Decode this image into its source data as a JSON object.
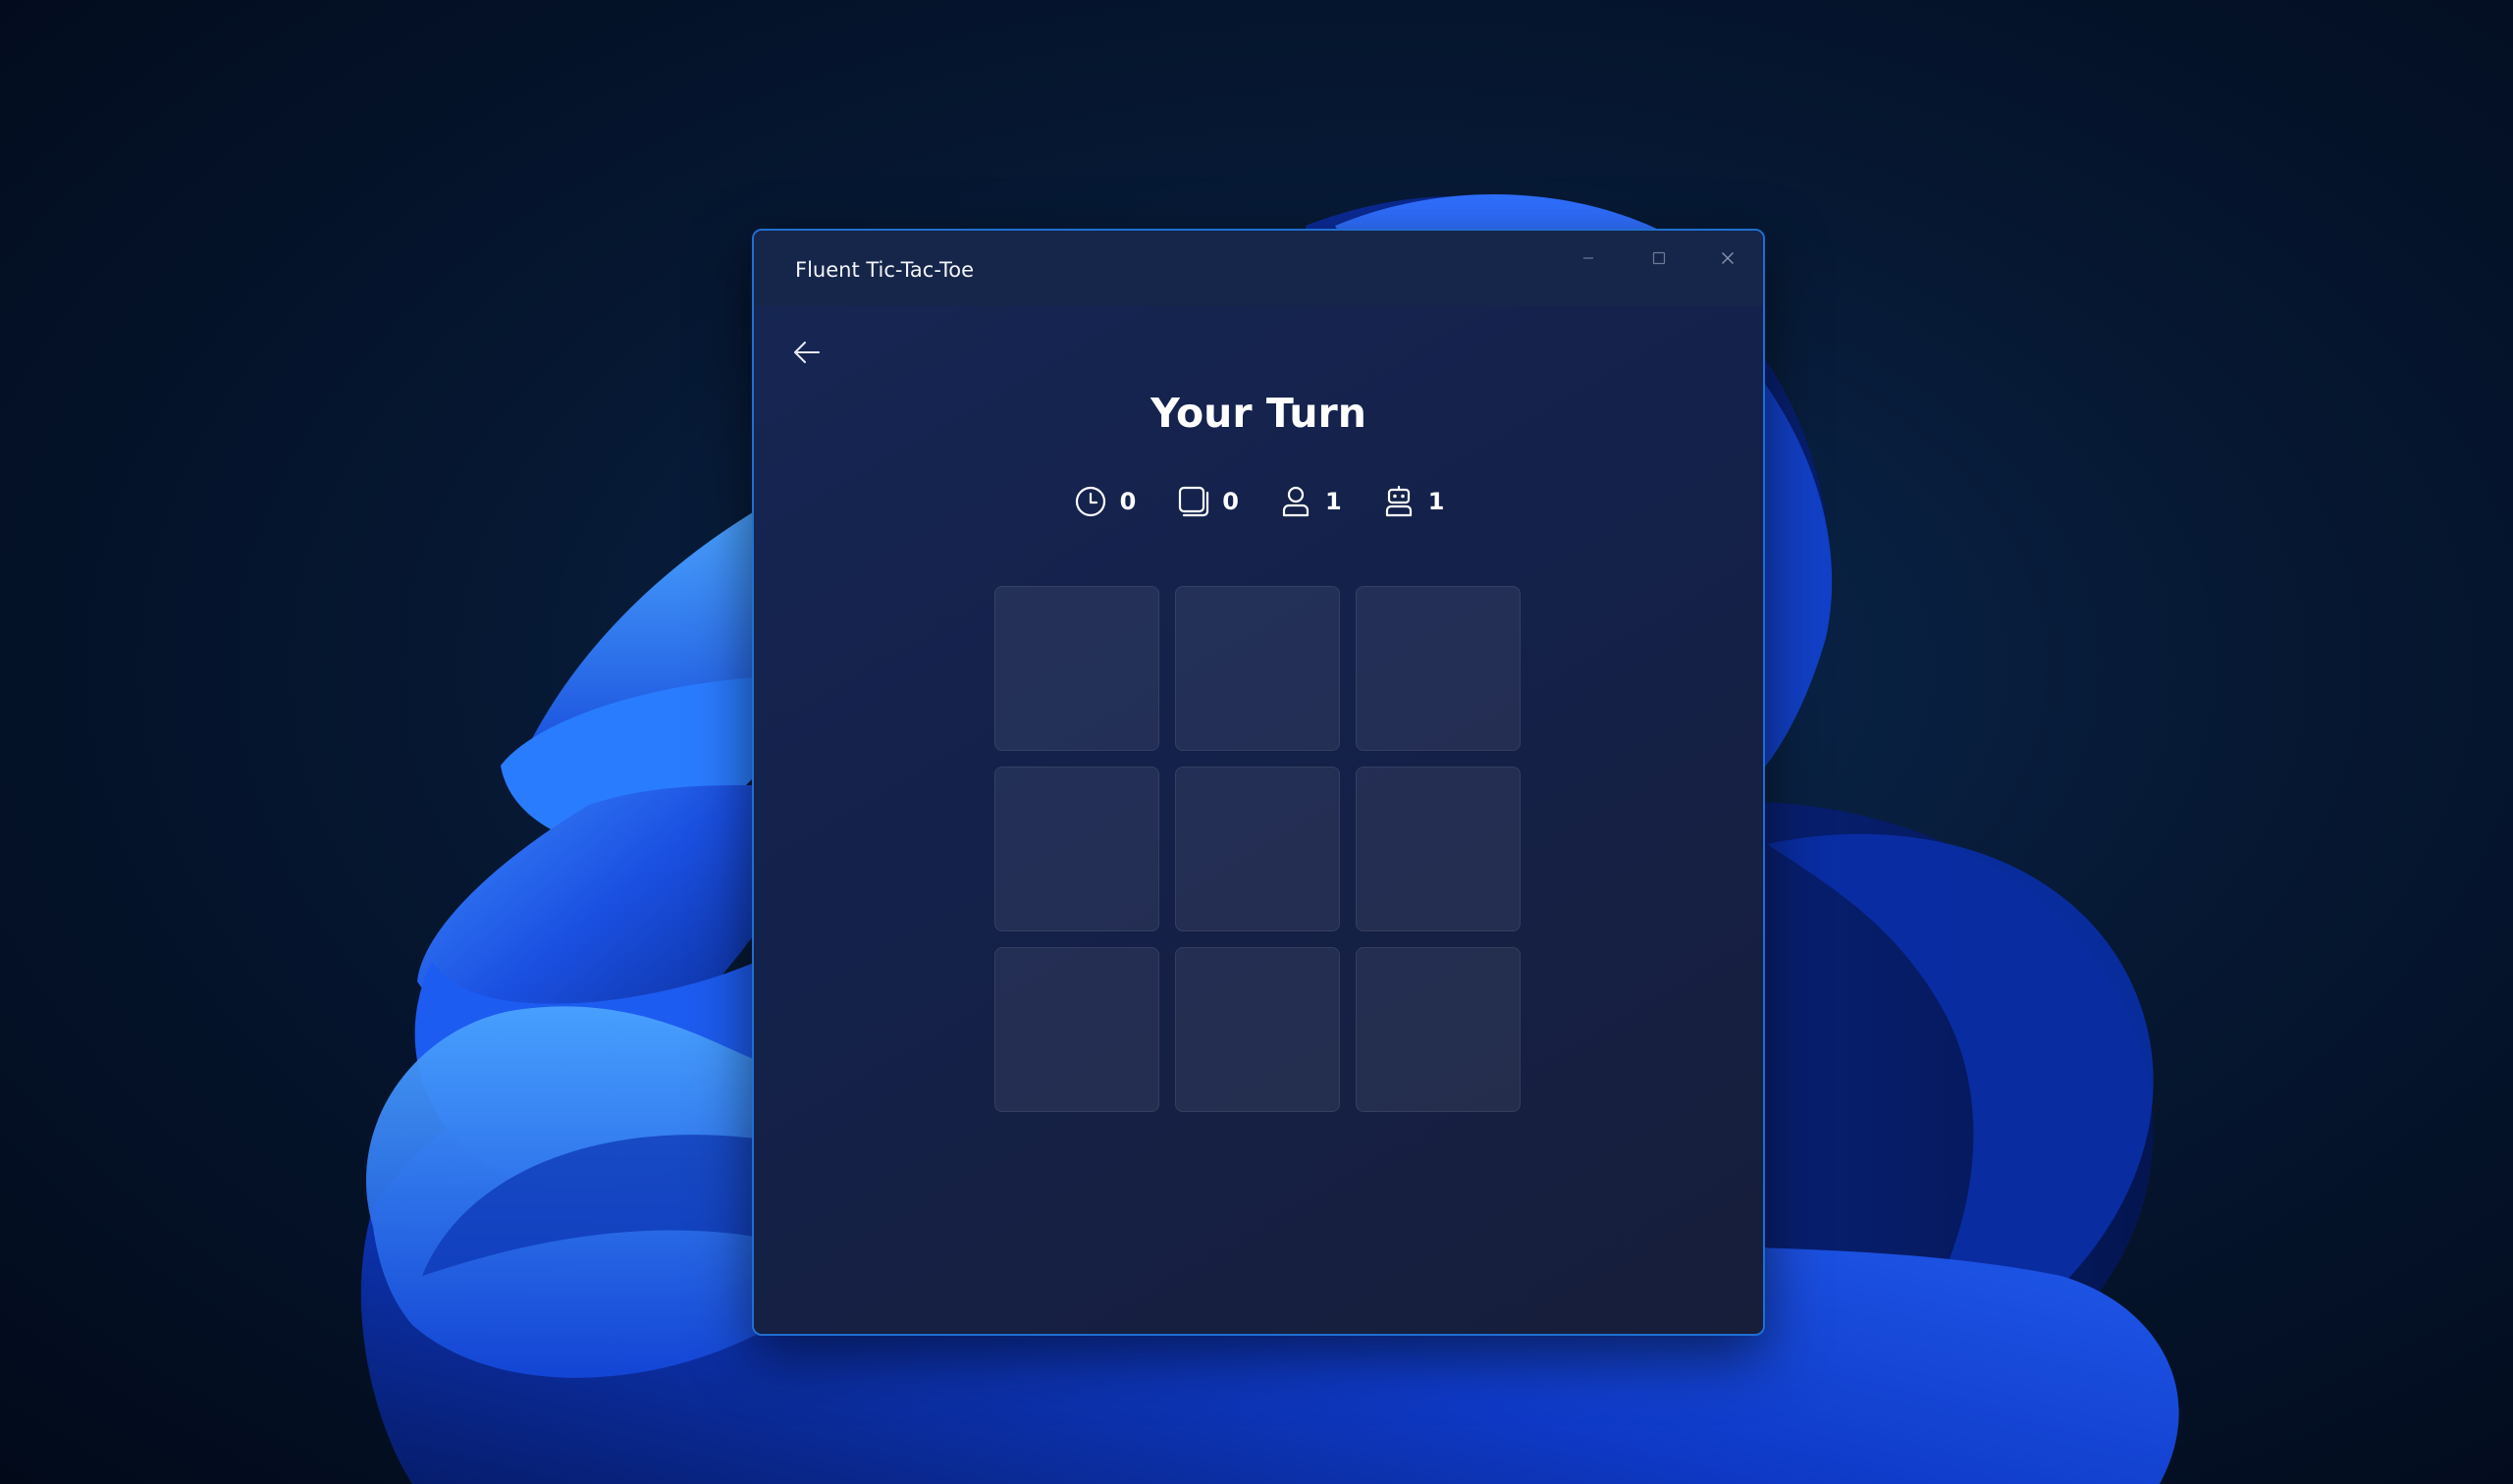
{
  "window": {
    "title": "Fluent Tic-Tac-Toe"
  },
  "caption_buttons": [
    "minimize-icon",
    "maximize-icon",
    "close-icon"
  ],
  "navigation": {
    "back_icon": "arrow-left-icon"
  },
  "game": {
    "status": "Your Turn",
    "stats": [
      {
        "icon": "clock-icon",
        "value": "0"
      },
      {
        "icon": "draws-icon",
        "value": "0"
      },
      {
        "icon": "person-icon",
        "value": "1"
      },
      {
        "icon": "bot-icon",
        "value": "1"
      }
    ],
    "board": [
      [
        "",
        "",
        ""
      ],
      [
        "",
        "",
        ""
      ],
      [
        "",
        "",
        ""
      ]
    ]
  },
  "colors": {
    "accent_border": "#1f6fd0",
    "text": "#ffffff"
  }
}
